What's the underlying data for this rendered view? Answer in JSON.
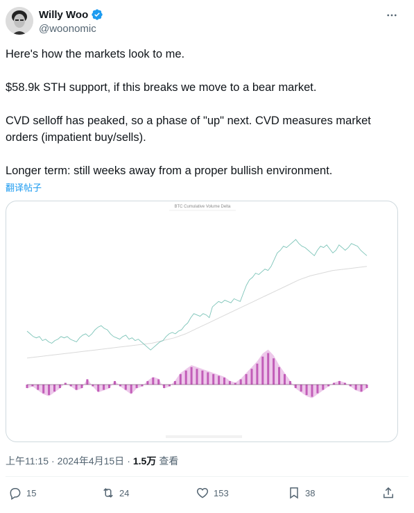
{
  "author": {
    "display_name": "Willy Woo",
    "handle": "@woonomic",
    "avatar_icon": "avatar-portrait",
    "verified_color": "#1d9bf0"
  },
  "tweet": {
    "paragraphs": [
      "Here's how the markets look to me.",
      "$58.9k STH support, if this breaks we move to a bear market.",
      "CVD selloff has peaked, so a phase of \"up\" next. CVD measures market orders (impatient buy/sells).",
      "Longer term: still weeks away from a proper bullish environment."
    ],
    "translate_label": "翻译帖子"
  },
  "chart_data": {
    "type": "line",
    "title": "BTC Cumulative Volume Delta",
    "series_colors": {
      "price": "#7cc4b8",
      "sth": "#d9d9d9",
      "cvd_area": "#e7b5e3",
      "cvd_bars": "#c25db8"
    },
    "price": [
      0.62,
      0.6,
      0.58,
      0.57,
      0.58,
      0.55,
      0.56,
      0.54,
      0.53,
      0.55,
      0.56,
      0.58,
      0.57,
      0.58,
      0.56,
      0.55,
      0.54,
      0.57,
      0.59,
      0.6,
      0.58,
      0.6,
      0.63,
      0.65,
      0.66,
      0.64,
      0.63,
      0.6,
      0.58,
      0.57,
      0.56,
      0.58,
      0.59,
      0.56,
      0.57,
      0.55,
      0.56,
      0.54,
      0.52,
      0.5,
      0.48,
      0.5,
      0.52,
      0.54,
      0.55,
      0.58,
      0.6,
      0.61,
      0.6,
      0.62,
      0.63,
      0.66,
      0.68,
      0.72,
      0.75,
      0.74,
      0.73,
      0.75,
      0.74,
      0.72,
      0.8,
      0.82,
      0.84,
      0.83,
      0.85,
      0.84,
      0.83,
      0.86,
      0.85,
      0.84,
      0.9,
      0.96,
      1.0,
      1.02,
      1.05,
      1.04,
      1.06,
      1.08,
      1.07,
      1.1,
      1.15,
      1.2,
      1.22,
      1.25,
      1.24,
      1.26,
      1.28,
      1.3,
      1.27,
      1.25,
      1.24,
      1.22,
      1.2,
      1.18,
      1.22,
      1.25,
      1.24,
      1.26,
      1.23,
      1.2,
      1.22,
      1.26,
      1.24,
      1.22,
      1.24,
      1.27,
      1.26,
      1.25,
      1.22,
      1.2,
      1.18
    ],
    "sth": [
      0.42,
      0.43,
      0.44,
      0.45,
      0.46,
      0.47,
      0.48,
      0.49,
      0.5,
      0.51,
      0.52,
      0.53,
      0.55,
      0.57,
      0.6,
      0.64,
      0.68,
      0.72,
      0.76,
      0.8,
      0.84,
      0.88,
      0.92,
      0.96,
      1.0,
      1.03,
      1.05,
      1.07,
      1.08,
      1.09,
      1.1
    ],
    "cvd": [
      -0.2,
      -0.1,
      -0.3,
      -0.5,
      -0.6,
      -0.4,
      -0.2,
      0.1,
      -0.1,
      -0.3,
      -0.2,
      0.3,
      -0.1,
      -0.4,
      -0.3,
      -0.2,
      0.2,
      -0.1,
      -0.3,
      -0.5,
      -0.2,
      -0.1,
      0.2,
      0.4,
      0.3,
      -0.2,
      -0.1,
      0.2,
      0.6,
      0.8,
      1.0,
      0.9,
      0.8,
      0.7,
      0.6,
      0.5,
      0.4,
      0.2,
      0.1,
      0.3,
      0.6,
      0.9,
      1.2,
      1.6,
      1.8,
      1.5,
      1.0,
      0.6,
      0.2,
      -0.2,
      -0.4,
      -0.6,
      -0.7,
      -0.5,
      -0.3,
      -0.1,
      0.1,
      0.2,
      0.1,
      -0.1,
      -0.3,
      -0.4,
      -0.2
    ]
  },
  "meta": {
    "time": "上午11:15",
    "date": "2024年4月15日",
    "sep": "·",
    "views_count": "1.5万",
    "views_label": "查看"
  },
  "actions": {
    "reply_count": "15",
    "repost_count": "24",
    "like_count": "153",
    "bookmark_count": "38"
  }
}
